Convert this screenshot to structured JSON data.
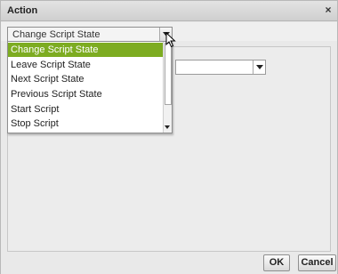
{
  "dialog": {
    "title": "Action",
    "close_label": "×"
  },
  "action_select": {
    "value": "Change Script State",
    "options": [
      "Change Script State",
      "Leave Script State",
      "Next Script State",
      "Previous Script State",
      "Start Script",
      "Stop Script"
    ],
    "selected_index": 0
  },
  "buttons": {
    "ok": "OK",
    "cancel": "Cancel"
  },
  "colors": {
    "selection": "#7dac21",
    "dialog_bg": "#e9e9e9"
  },
  "icons": {
    "dropdown_arrow": "chevron-down-icon",
    "cursor": "mouse-pointer-icon"
  }
}
